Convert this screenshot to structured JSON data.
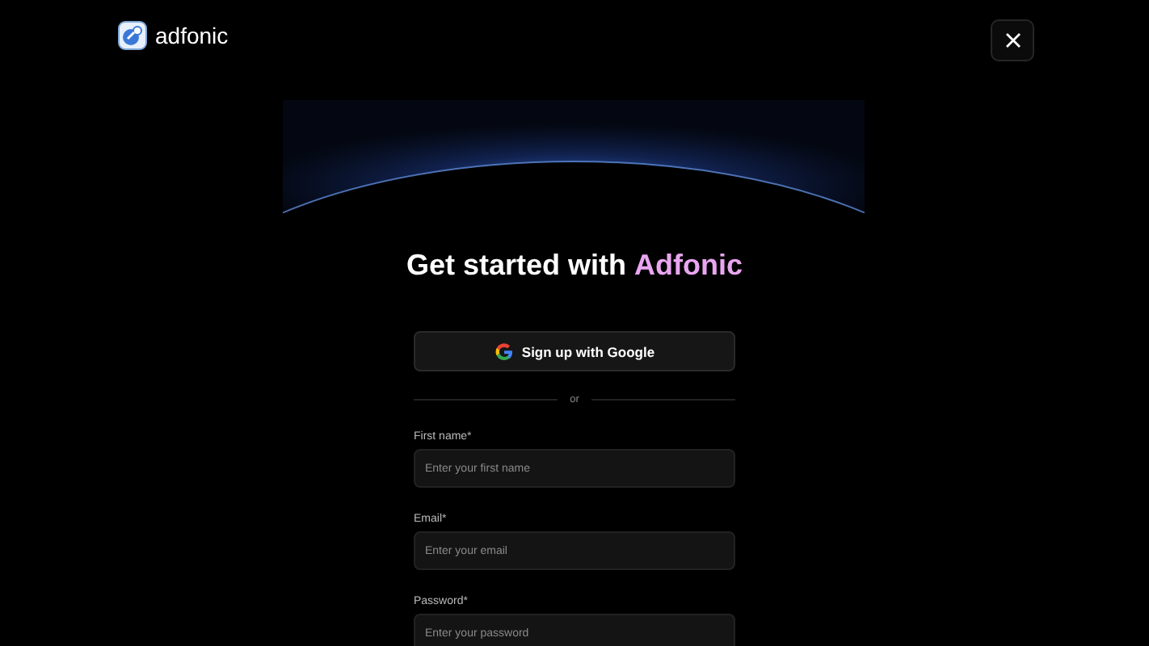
{
  "header": {
    "logo_text": "adfonic"
  },
  "title": {
    "text": "Get started with",
    "brand": "Adfonic"
  },
  "google_button": {
    "label": "Sign up with Google"
  },
  "divider": {
    "label": "or"
  },
  "fields": [
    {
      "label": "First name*",
      "placeholder": "Enter your first name"
    },
    {
      "label": "Email*",
      "placeholder": "Enter your email"
    },
    {
      "label": "Password*",
      "placeholder": "Enter your password"
    }
  ]
}
